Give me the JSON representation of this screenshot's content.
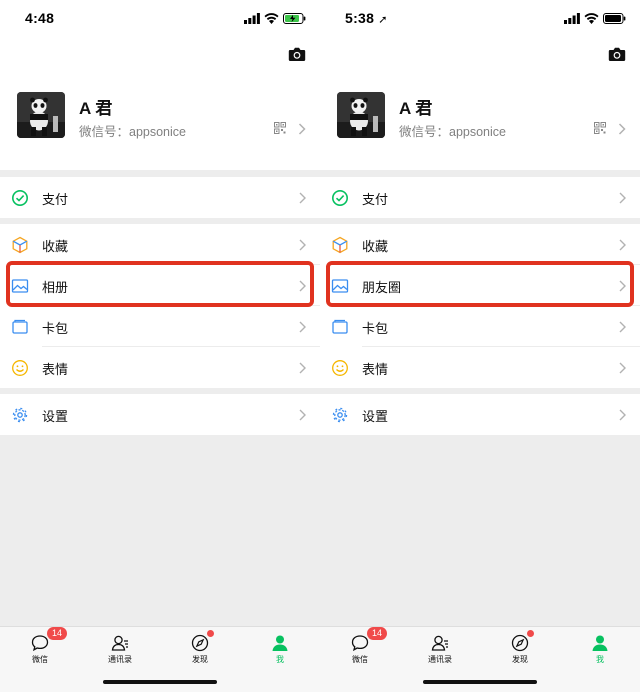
{
  "colors": {
    "accent_green": "#07c160",
    "highlight_red": "#e0321f",
    "badge_red": "#f04a4a",
    "background": "#ededed"
  },
  "panels": [
    {
      "status": {
        "time": "4:48",
        "location_arrow": ""
      },
      "profile": {
        "name": "A 君",
        "wechat_id": "微信号：appsonice"
      },
      "menu": {
        "pay": "支付",
        "favorites": "收藏",
        "moments": "相册",
        "cards": "卡包",
        "stickers": "表情",
        "settings": "设置"
      },
      "tabs": {
        "chats": "微信",
        "chats_badge": "14",
        "contacts": "通讯录",
        "discover": "发现",
        "me": "我"
      }
    },
    {
      "status": {
        "time": "5:38",
        "location_arrow": "➚"
      },
      "profile": {
        "name": "A 君",
        "wechat_id": "微信号：appsonice"
      },
      "menu": {
        "pay": "支付",
        "favorites": "收藏",
        "moments": "朋友圈",
        "cards": "卡包",
        "stickers": "表情",
        "settings": "设置"
      },
      "tabs": {
        "chats": "微信",
        "chats_badge": "14",
        "contacts": "通讯录",
        "discover": "发现",
        "me": "我"
      }
    }
  ],
  "icons": [
    "signal-icon",
    "wifi-icon",
    "battery-icon",
    "camera-icon",
    "qr-code-icon",
    "chevron-right-icon",
    "wallet-icon",
    "favorites-cube-icon",
    "album-image-icon",
    "card-icon",
    "sticker-smiley-icon",
    "settings-gear-icon",
    "chats-bubble-icon",
    "contacts-person-icon",
    "discover-compass-icon",
    "me-person-icon"
  ]
}
